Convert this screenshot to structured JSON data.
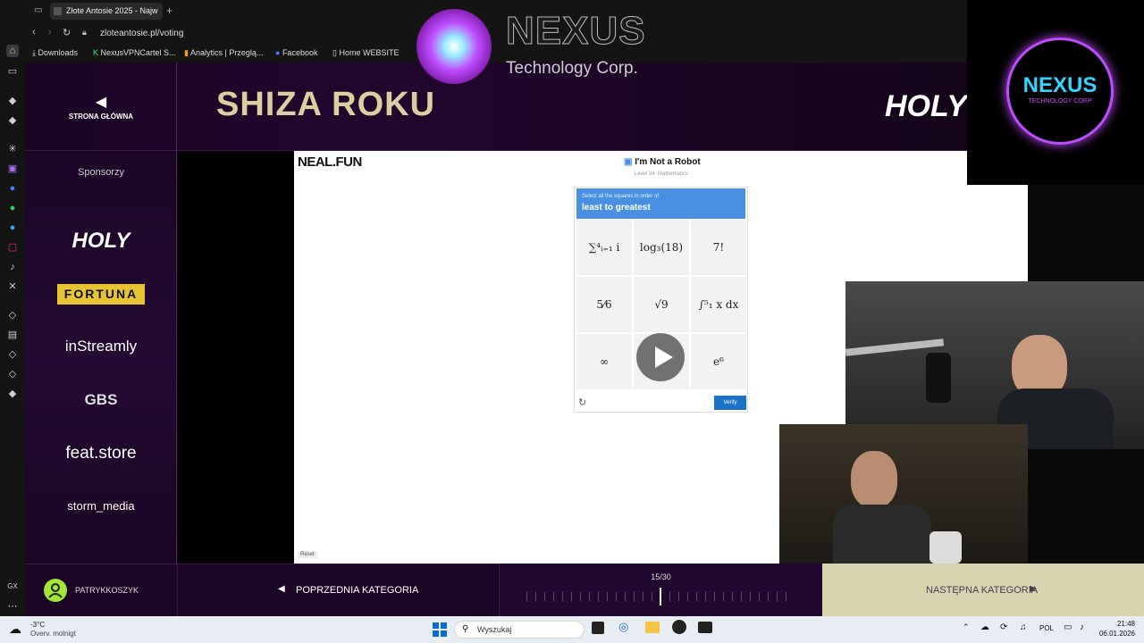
{
  "browser": {
    "tab_title": "Złote Antosie 2025 - Najw",
    "url": "zloteantosie.pl/voting",
    "bookmarks": [
      "Downloads",
      "NexusVPNCartel S...",
      "Analytics | Przeglą...",
      "Facebook",
      "Home WEBSITE"
    ]
  },
  "overlay": {
    "nexus_title": "NEXUS",
    "nexus_subtitle": "Technology Corp.",
    "nexus_logo_title": "NEXUS",
    "nexus_logo_sub": "TECHNOLOGY CORP"
  },
  "site": {
    "home_label": "STRONA GŁÓWNA",
    "category_title": "SHIZA ROKU",
    "header_brand": "HOLY",
    "sponsors_heading": "Sponsorzy",
    "sponsors": [
      "HOLY",
      "FORTUNA",
      "inStreamly",
      "GBS",
      "feat.store",
      "storm_media"
    ],
    "user_name": "PATRYKKOSZYK",
    "prev_label": "POPRZEDNIA KATEGORIA",
    "next_label": "NASTĘPNA KATEGORIA",
    "progress_text": "15/30",
    "progress_value": 0.5
  },
  "game": {
    "logo": "NEAL.FUN",
    "title": "I'm Not a Robot",
    "level": "Level 34: Mathematics",
    "instruction_small": "Select all the squares in order of",
    "instruction_big": "least to greatest",
    "cells": [
      "∑⁴ᵢ₌₁ i",
      "log₃(18)",
      "7!",
      "5⁄6",
      "√9",
      "∫⁵₁ x dx",
      "∞",
      "",
      "e⁶"
    ],
    "verify_label": "Verify",
    "reset_label": "Reset"
  },
  "taskbar": {
    "weather_temp": "-3°C",
    "weather_desc": "Overv. molnigt",
    "search_placeholder": "Wyszukaj",
    "lang": "POL",
    "time": "21:48",
    "date": "06.01.2026"
  },
  "colors": {
    "accent_purple": "#2a0838",
    "captcha_blue": "#4a90e2",
    "verify_blue": "#1a73c8",
    "gold": "#d9cfa0"
  }
}
